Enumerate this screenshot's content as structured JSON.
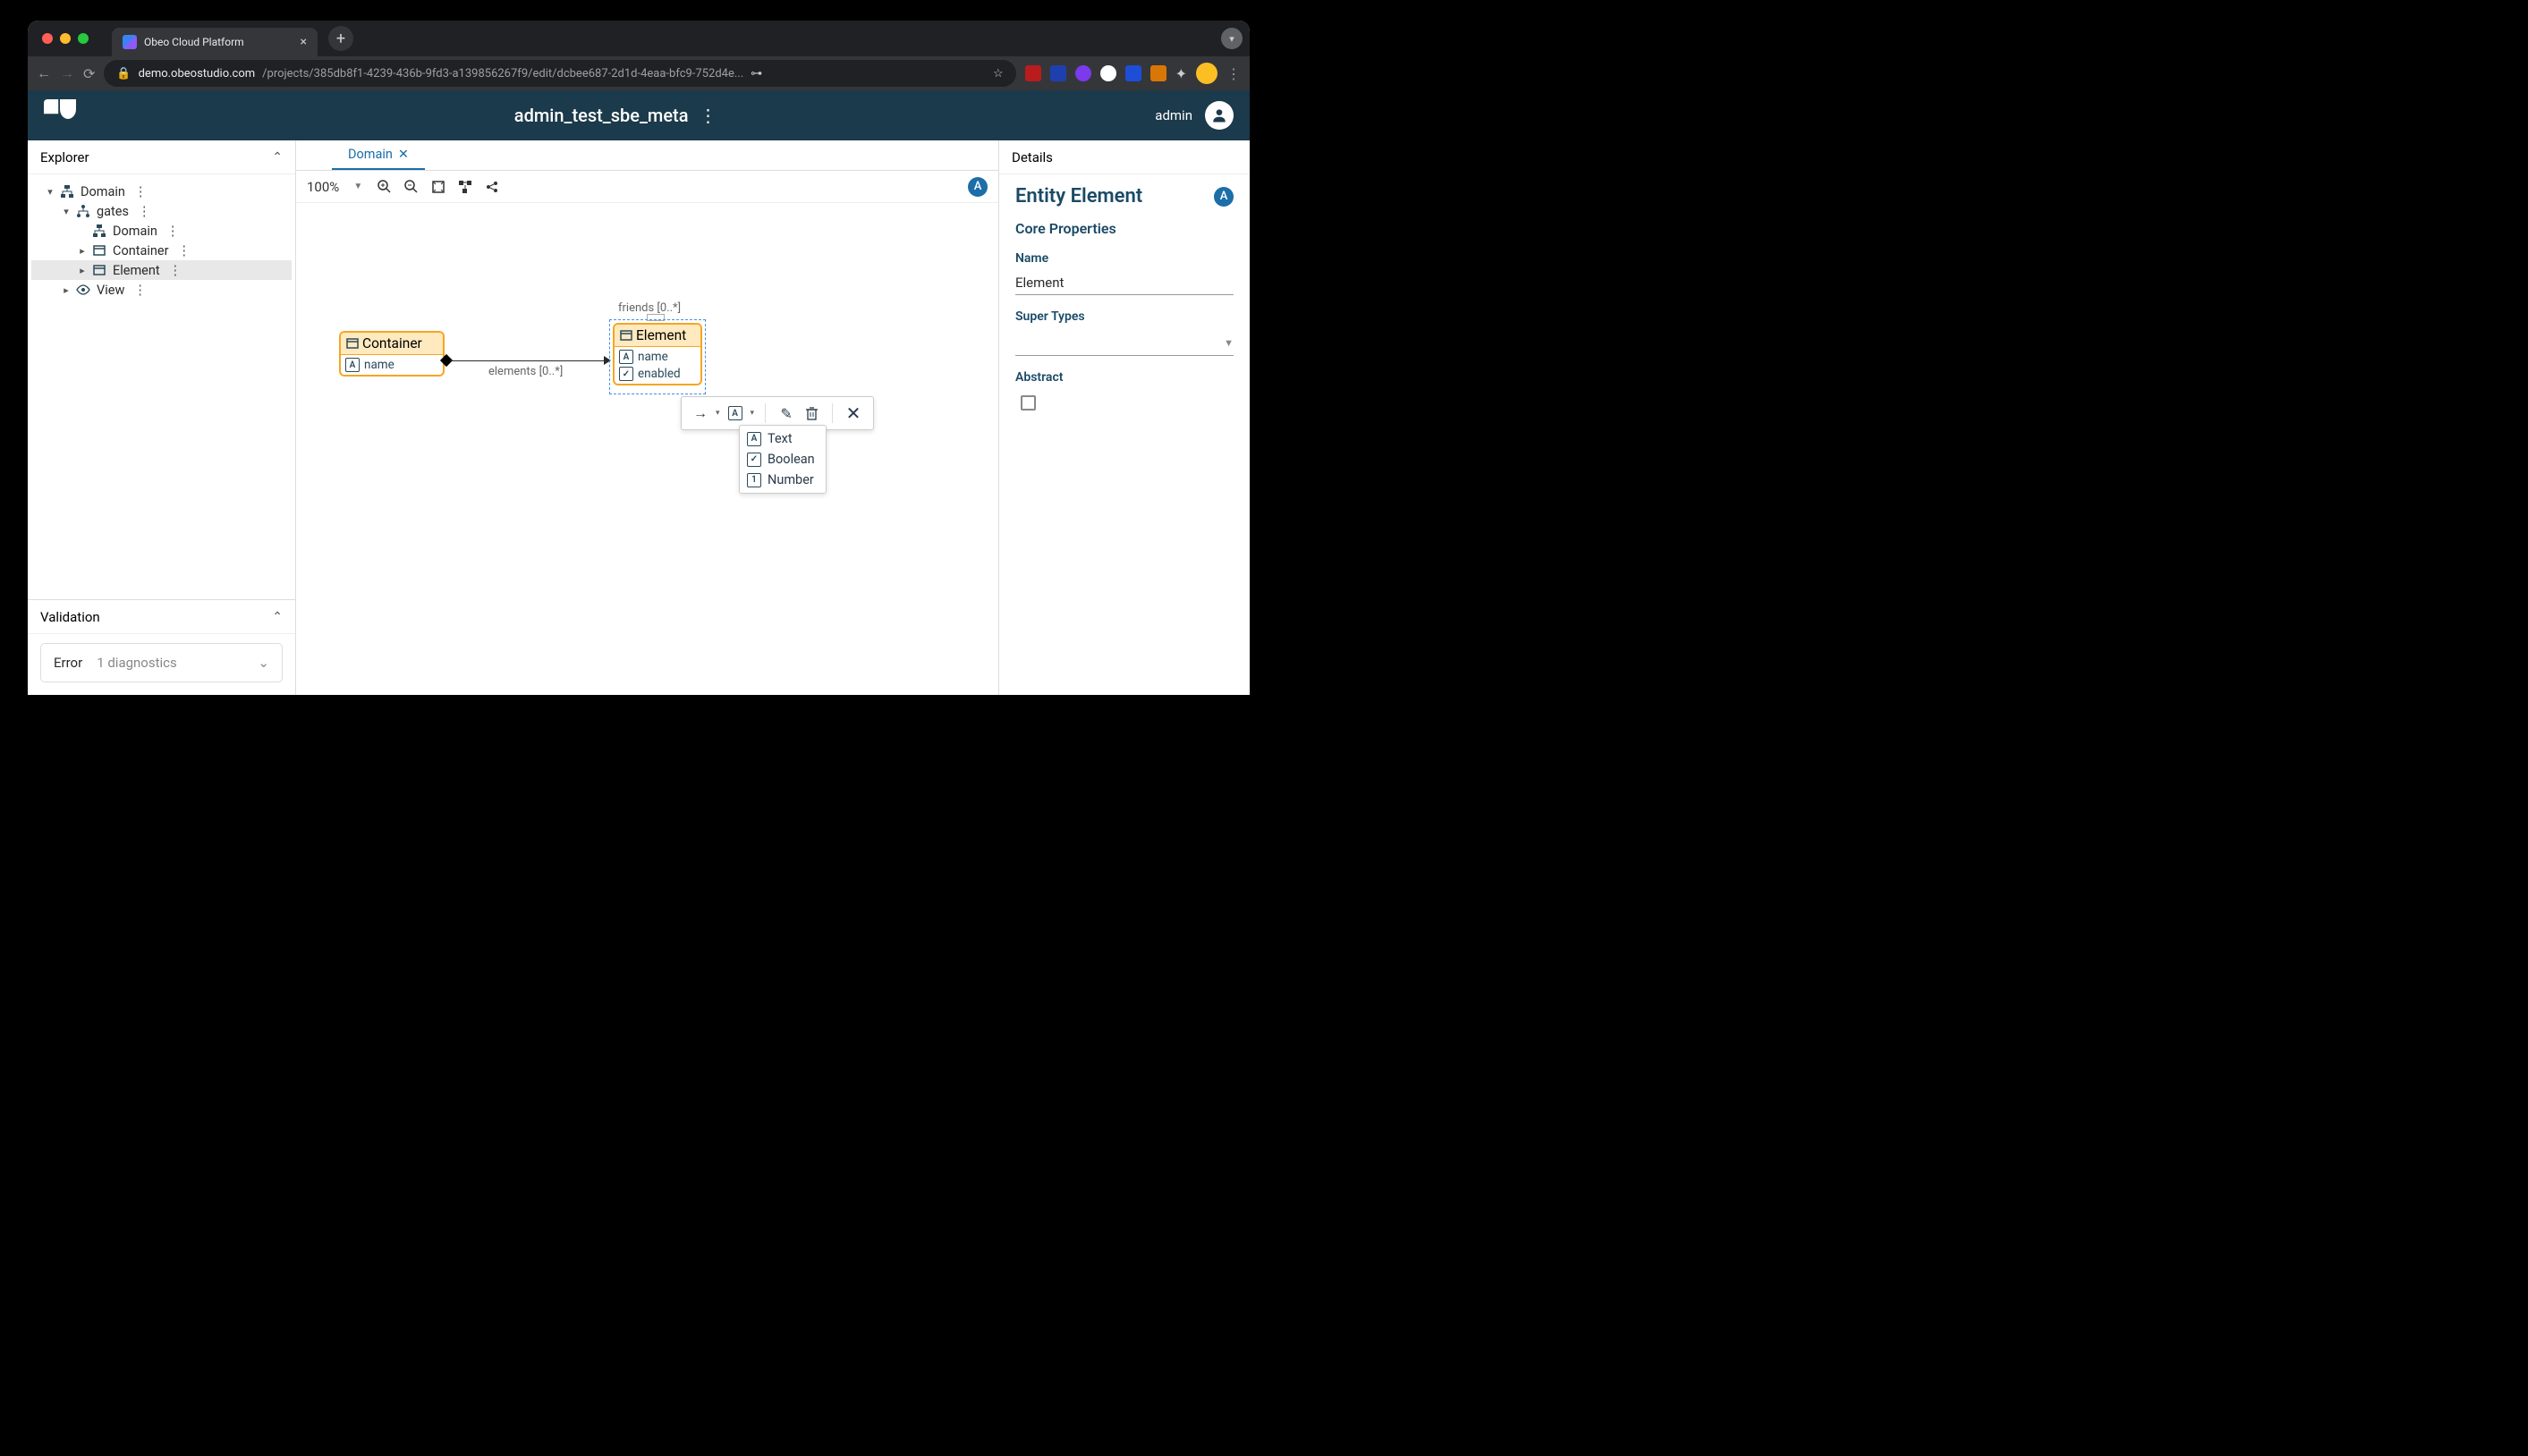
{
  "browser": {
    "tab_title": "Obeo Cloud Platform",
    "url_domain": "demo.obeostudio.com",
    "url_path": "/projects/385db8f1-4239-436b-9fd3-a139856267f9/edit/dcbee687-2d1d-4eaa-bfc9-752d4e..."
  },
  "header": {
    "project_title": "admin_test_sbe_meta",
    "user": "admin"
  },
  "explorer": {
    "title": "Explorer",
    "tree": {
      "root": "Domain",
      "gates": "gates",
      "domain": "Domain",
      "container": "Container",
      "element": "Element",
      "view": "View"
    }
  },
  "validation": {
    "title": "Validation",
    "error_label": "Error",
    "diag_label": "1 diagnostics"
  },
  "center": {
    "tab": "Domain",
    "zoom": "100%",
    "badge": "A"
  },
  "diagram": {
    "node1": {
      "title": "Container",
      "attr1": "name"
    },
    "node2": {
      "title": "Element",
      "attr1": "name",
      "attr2": "enabled"
    },
    "edge1": "elements [0..*]",
    "edge2": "friends [0..*]"
  },
  "popup": {
    "text": "Text",
    "boolean": "Boolean",
    "number": "Number"
  },
  "details": {
    "title": "Details",
    "heading": "Entity Element",
    "badge": "A",
    "core": "Core Properties",
    "name_label": "Name",
    "name_value": "Element",
    "super_label": "Super Types",
    "abstract_label": "Abstract"
  }
}
